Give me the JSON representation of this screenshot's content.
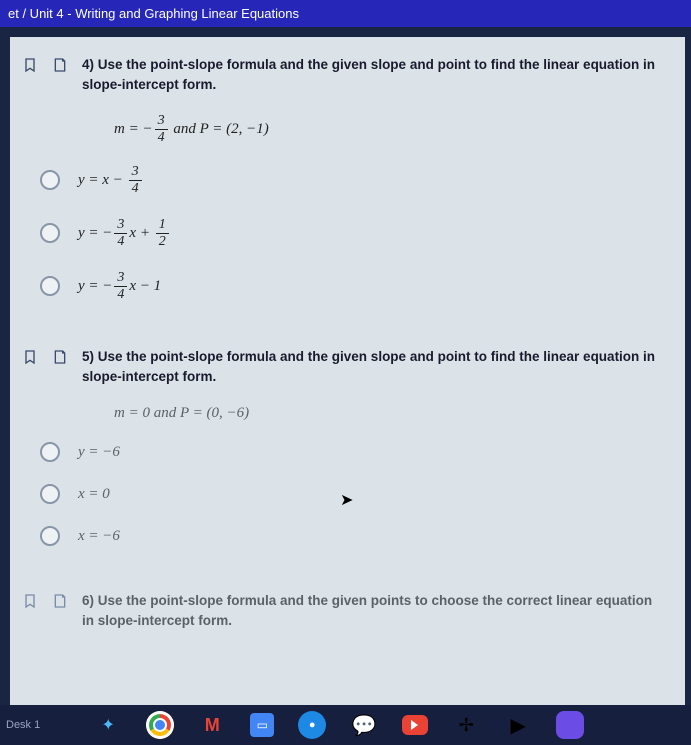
{
  "header": "et / Unit 4 - Writing and Graphing Linear Equations",
  "q4": {
    "num": "4)",
    "prompt": "Use the point-slope formula and the given slope and point to find the linear equation in slope-intercept form.",
    "given_pre": "m = −",
    "given_frac_n": "3",
    "given_frac_d": "4",
    "given_mid": "  and  P = (2, −1)",
    "optA_pre": "y = x −",
    "optA_n": "3",
    "optA_d": "4",
    "optB_pre": "y = −",
    "optB_n1": "3",
    "optB_d1": "4",
    "optB_mid": "x +",
    "optB_n2": "1",
    "optB_d2": "2",
    "optC_pre": "y = −",
    "optC_n": "3",
    "optC_d": "4",
    "optC_post": "x − 1"
  },
  "q5": {
    "num": "5)",
    "prompt": "Use the point-slope formula and the given slope and point to find the linear equation in slope-intercept form.",
    "given": "m = 0   and   P = (0, −6)",
    "optA": "y = −6",
    "optB": "x = 0",
    "optC": "x = −6"
  },
  "q6": {
    "num": "6)",
    "prompt": "Use the point-slope formula and the given points to choose the correct linear equation in slope-intercept form."
  },
  "taskbar": {
    "desk": "Desk 1"
  }
}
